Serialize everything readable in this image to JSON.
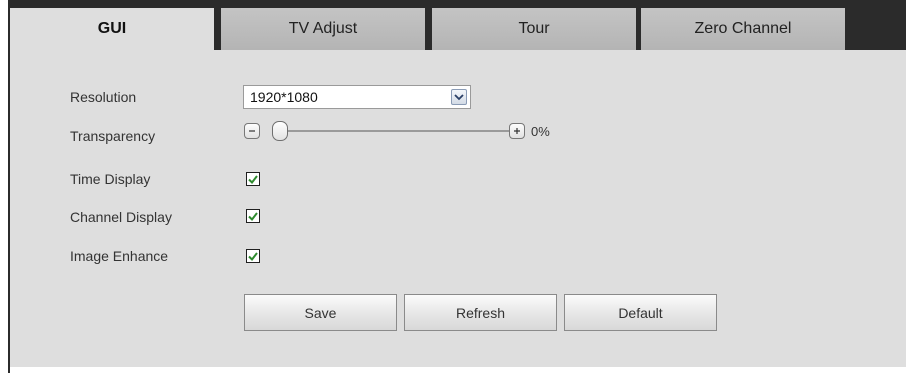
{
  "tabs": [
    {
      "label": "GUI",
      "active": true
    },
    {
      "label": "TV Adjust",
      "active": false
    },
    {
      "label": "Tour",
      "active": false
    },
    {
      "label": "Zero Channel",
      "active": false
    }
  ],
  "form": {
    "resolution_label": "Resolution",
    "resolution_value": "1920*1080",
    "transparency_label": "Transparency",
    "transparency_value": "0%",
    "transparency_level": 0,
    "time_display_label": "Time Display",
    "time_display_checked": true,
    "channel_display_label": "Channel Display",
    "channel_display_checked": true,
    "image_enhance_label": "Image Enhance",
    "image_enhance_checked": true
  },
  "buttons": {
    "save": "Save",
    "refresh": "Refresh",
    "default": "Default"
  },
  "colors": {
    "tab_bar": "#2b2b2b",
    "panel_bg": "#dedede",
    "checkmark": "#2e8b2e"
  }
}
